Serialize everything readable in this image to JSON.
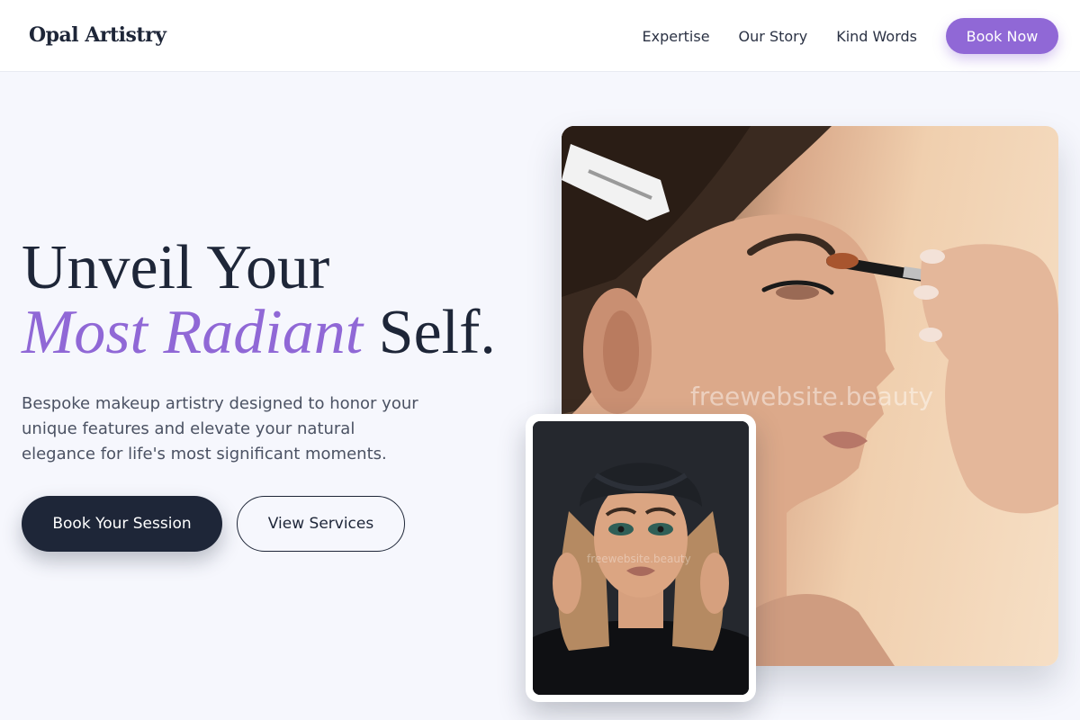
{
  "header": {
    "logo": "Opal Artistry",
    "nav": [
      {
        "label": "Expertise"
      },
      {
        "label": "Our Story"
      },
      {
        "label": "Kind Words"
      }
    ],
    "cta_label": "Book Now"
  },
  "hero": {
    "title_line1": "Unveil Your",
    "title_accent": "Most Radiant",
    "title_end": " Self.",
    "subtitle": "Bespoke makeup artistry designed to honor your unique features and elevate your natural elegance for life's most significant moments.",
    "primary_button": "Book Your Session",
    "secondary_button": "View Services"
  },
  "images": {
    "main_watermark": "freewebsite.beauty",
    "inset_watermark": "freewebsite.beauty"
  },
  "colors": {
    "accent": "#9068d6",
    "dark": "#1e2638",
    "background": "#f6f7fd"
  }
}
